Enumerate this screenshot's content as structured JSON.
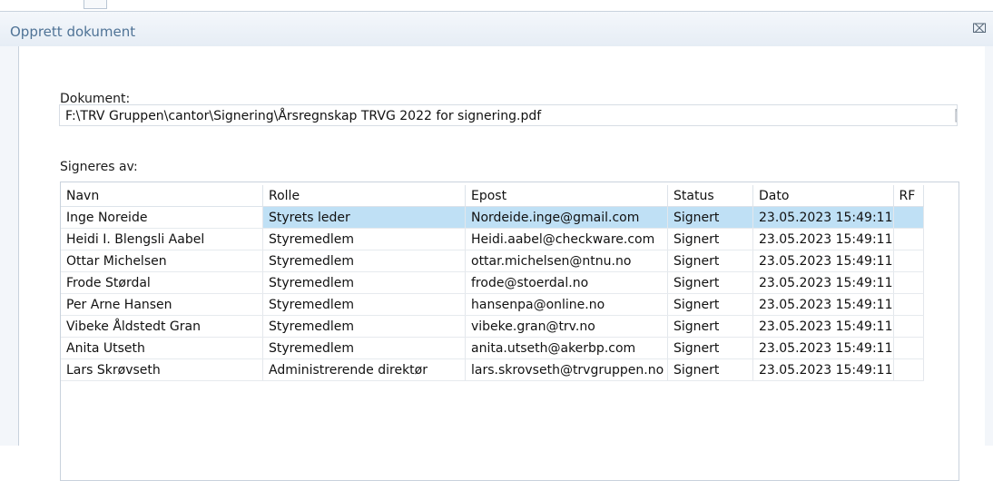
{
  "window": {
    "title": "Opprett dokument",
    "close_label": "⌧"
  },
  "document": {
    "label": "Dokument:",
    "path": "F:\\TRV Gruppen\\cantor\\Signering\\Årsregnskap TRVG 2022 for signering.pdf"
  },
  "signers": {
    "label": "Signeres av:",
    "columns": [
      "Navn",
      "Rolle",
      "Epost",
      "Status",
      "Dato",
      "RF"
    ],
    "selected_row": 0,
    "rows": [
      {
        "navn": "Inge Noreide",
        "rolle": "Styrets leder",
        "epost": "Nordeide.inge@gmail.com",
        "status": "Signert",
        "dato": "23.05.2023 15:49:11",
        "rf": ""
      },
      {
        "navn": "Heidi I. Blengsli Aabel",
        "rolle": "Styremedlem",
        "epost": "Heidi.aabel@checkware.com",
        "status": "Signert",
        "dato": "23.05.2023 15:49:11",
        "rf": ""
      },
      {
        "navn": "Ottar Michelsen",
        "rolle": "Styremedlem",
        "epost": "ottar.michelsen@ntnu.no",
        "status": "Signert",
        "dato": "23.05.2023 15:49:11",
        "rf": ""
      },
      {
        "navn": "Frode Størdal",
        "rolle": "Styremedlem",
        "epost": "frode@stoerdal.no",
        "status": "Signert",
        "dato": "23.05.2023 15:49:11",
        "rf": ""
      },
      {
        "navn": "Per Arne Hansen",
        "rolle": "Styremedlem",
        "epost": "hansenpa@online.no",
        "status": "Signert",
        "dato": "23.05.2023 15:49:11",
        "rf": ""
      },
      {
        "navn": "Vibeke Åldstedt Gran",
        "rolle": "Styremedlem",
        "epost": "vibeke.gran@trv.no",
        "status": "Signert",
        "dato": "23.05.2023 15:49:11",
        "rf": ""
      },
      {
        "navn": "Anita Utseth",
        "rolle": "Styremedlem",
        "epost": "anita.utseth@akerbp.com",
        "status": "Signert",
        "dato": "23.05.2023 15:49:11",
        "rf": ""
      },
      {
        "navn": "Lars Skrøvseth",
        "rolle": "Administrerende direktør",
        "epost": "lars.skrovseth@trvgruppen.no",
        "status": "Signert",
        "dato": "23.05.2023 15:49:11",
        "rf": ""
      }
    ]
  },
  "icons": {
    "close": "close-icon",
    "browse": "folder-browse-icon"
  },
  "colors": {
    "title_text": "#4f7396",
    "selected_cell": "#bfe0f5"
  }
}
